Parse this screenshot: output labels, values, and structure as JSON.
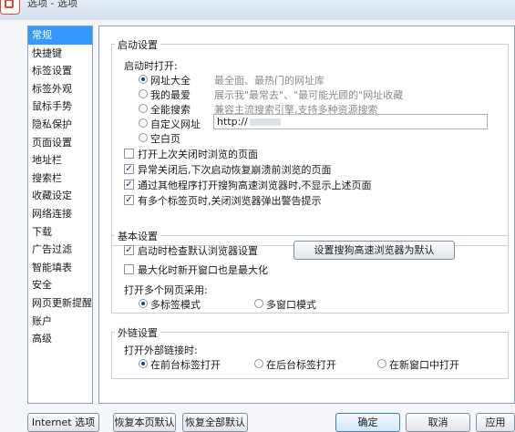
{
  "window": {
    "title": "选项 - 选项"
  },
  "sidebar": {
    "items": [
      {
        "label": "常规",
        "selected": true
      },
      {
        "label": "快捷键"
      },
      {
        "label": "标签设置"
      },
      {
        "label": "标签外观"
      },
      {
        "label": "鼠标手势"
      },
      {
        "label": "隐私保护"
      },
      {
        "label": "页面设置"
      },
      {
        "label": "地址栏"
      },
      {
        "label": "搜索栏"
      },
      {
        "label": "收藏设定"
      },
      {
        "label": "网络连接"
      },
      {
        "label": "下载"
      },
      {
        "label": "广告过滤"
      },
      {
        "label": "智能填表"
      },
      {
        "label": "安全"
      },
      {
        "label": "网页更新提醒"
      },
      {
        "label": "账户"
      },
      {
        "label": "高级"
      }
    ]
  },
  "startup": {
    "group_title": "启动设置",
    "open_label": "启动时打开:",
    "options": [
      {
        "label": "网址大全",
        "desc": "最全面、最热门的网址库",
        "selected": true
      },
      {
        "label": "我的最爱",
        "desc": "展示我\"最常去\"、\"最可能光顾的\"网址收藏",
        "selected": false
      },
      {
        "label": "全能搜索",
        "desc": "兼容主流搜索引擎,支持多种资源搜索",
        "selected": false
      },
      {
        "label": "自定义网址",
        "desc": "",
        "selected": false
      },
      {
        "label": "空白页",
        "desc": "",
        "selected": false
      }
    ],
    "custom_url": "http://",
    "checkboxes": [
      {
        "label": "打开上次关闭时浏览的页面",
        "checked": false
      },
      {
        "label": "异常关闭后,下次启动恢复崩溃前浏览的页面",
        "checked": true
      },
      {
        "label": "通过其他程序打开搜狗高速浏览器时,不显示上述页面",
        "checked": true
      },
      {
        "label": "有多个标签页时,关闭浏览器弹出警告提示",
        "checked": true
      }
    ]
  },
  "basic": {
    "group_title": "基本设置",
    "check_default": {
      "label": "启动时检查默认浏览器设置",
      "checked": true
    },
    "set_default_button": "设置搜狗高速浏览器为默认",
    "maximize": {
      "label": "最大化时新开窗口也是最大化",
      "checked": false
    },
    "multi_label": "打开多个网页采用:",
    "multi_tab": {
      "label": "多标签模式",
      "selected": true
    },
    "multi_window": {
      "label": "多窗口模式",
      "selected": false
    }
  },
  "links": {
    "group_title": "外链设置",
    "open_label": "打开外部链接时:",
    "options": [
      {
        "label": "在前台标签打开",
        "selected": true
      },
      {
        "label": "在后台标签打开",
        "selected": false
      },
      {
        "label": "在新窗口中打开",
        "selected": false
      }
    ]
  },
  "footer": {
    "internet_options": "Internet 选项",
    "restore_page": "恢复本页默认",
    "restore_all": "恢复全部默认",
    "ok": "确定",
    "cancel": "取消",
    "apply": "应用"
  },
  "check_mark": "✓"
}
